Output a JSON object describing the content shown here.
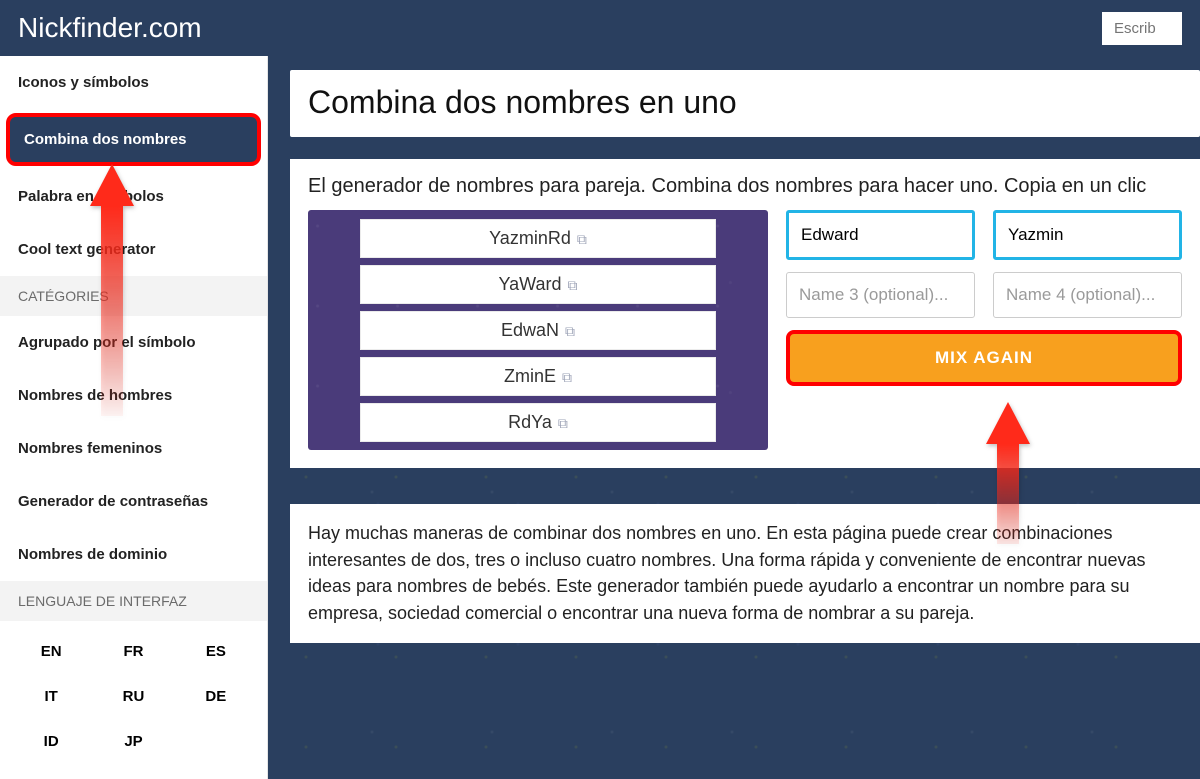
{
  "header": {
    "logo": "Nickfinder.com",
    "searchPlaceholder": "Escrib"
  },
  "sidebar": {
    "topItems": [
      {
        "label": "Iconos y símbolos"
      },
      {
        "label": "Combina dos nombres"
      },
      {
        "label": "Palabra en símbolos"
      },
      {
        "label": "Cool text generator"
      }
    ],
    "catHeader": "CATÉGORIES",
    "catItems": [
      {
        "label": "Agrupado por el símbolo"
      },
      {
        "label": "Nombres de hombres"
      },
      {
        "label": "Nombres femeninos"
      },
      {
        "label": "Generador de contraseñas"
      },
      {
        "label": "Nombres de dominio"
      }
    ],
    "langHeader": "LENGUAJE DE INTERFAZ",
    "langs": [
      "EN",
      "FR",
      "ES",
      "IT",
      "RU",
      "DE",
      "ID",
      "JP"
    ]
  },
  "main": {
    "title": "Combina dos nombres en uno",
    "subtitle": "El generador de nombres para pareja. Combina dos nombres para hacer uno. Copia en un clic",
    "results": [
      "YazminRd",
      "YaWard",
      "EdwaN",
      "ZminE",
      "RdYa"
    ],
    "inputs": {
      "name1": "Edward",
      "name2": "Yazmin",
      "ph3": "Name 3 (optional)...",
      "ph4": "Name 4 (optional)..."
    },
    "mixLabel": "MIX AGAIN",
    "description": "Hay muchas maneras de combinar dos nombres en uno. En esta página puede crear combinaciones interesantes de dos, tres o incluso cuatro nombres. Una forma rápida y conveniente de encontrar nuevas ideas para nombres de bebés. Este generador también puede ayudarlo a encontrar un nombre para su empresa, sociedad comercial o encontrar una nueva forma de nombrar a su pareja."
  }
}
